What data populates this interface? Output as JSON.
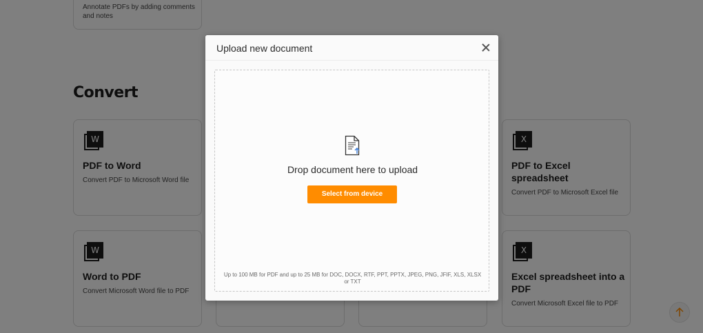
{
  "background": {
    "annotate_card": {
      "desc": "Annotate PDFs by adding comments and notes"
    },
    "section_title": "Convert",
    "cards": {
      "pdf_to_word": {
        "icon_letter": "W",
        "title": "PDF to Word",
        "desc": "Convert PDF to Microsoft Word file"
      },
      "pdf_to_excel": {
        "icon_letter": "X",
        "title": "PDF to Excel spreadsheet",
        "desc": "Convert PDF to Microsoft Excel file"
      },
      "word_to_pdf": {
        "icon_letter": "W",
        "title": "Word to PDF",
        "desc": "Convert Microsoft Word file to PDF"
      },
      "excel_to_pdf": {
        "icon_letter": "X",
        "title": "Excel spreadsheet into a PDF",
        "desc": "Convert Microsoft Excel file to PDF"
      }
    }
  },
  "modal": {
    "title": "Upload new document",
    "drop_text": "Drop document here to upload",
    "select_button": "Select from device",
    "limits": "Up to 100 MB for PDF and up to 25 MB for DOC, DOCX, RTF, PPT, PPTX, JPEG, PNG, JFIF, XLS, XLSX or TXT"
  },
  "icons": {
    "close": "close-icon",
    "document_upload": "document-upload-icon",
    "scroll_top": "arrow-up-icon"
  },
  "colors": {
    "accent": "#ff8c00",
    "overlay": "rgba(0,0,0,0.5)"
  }
}
